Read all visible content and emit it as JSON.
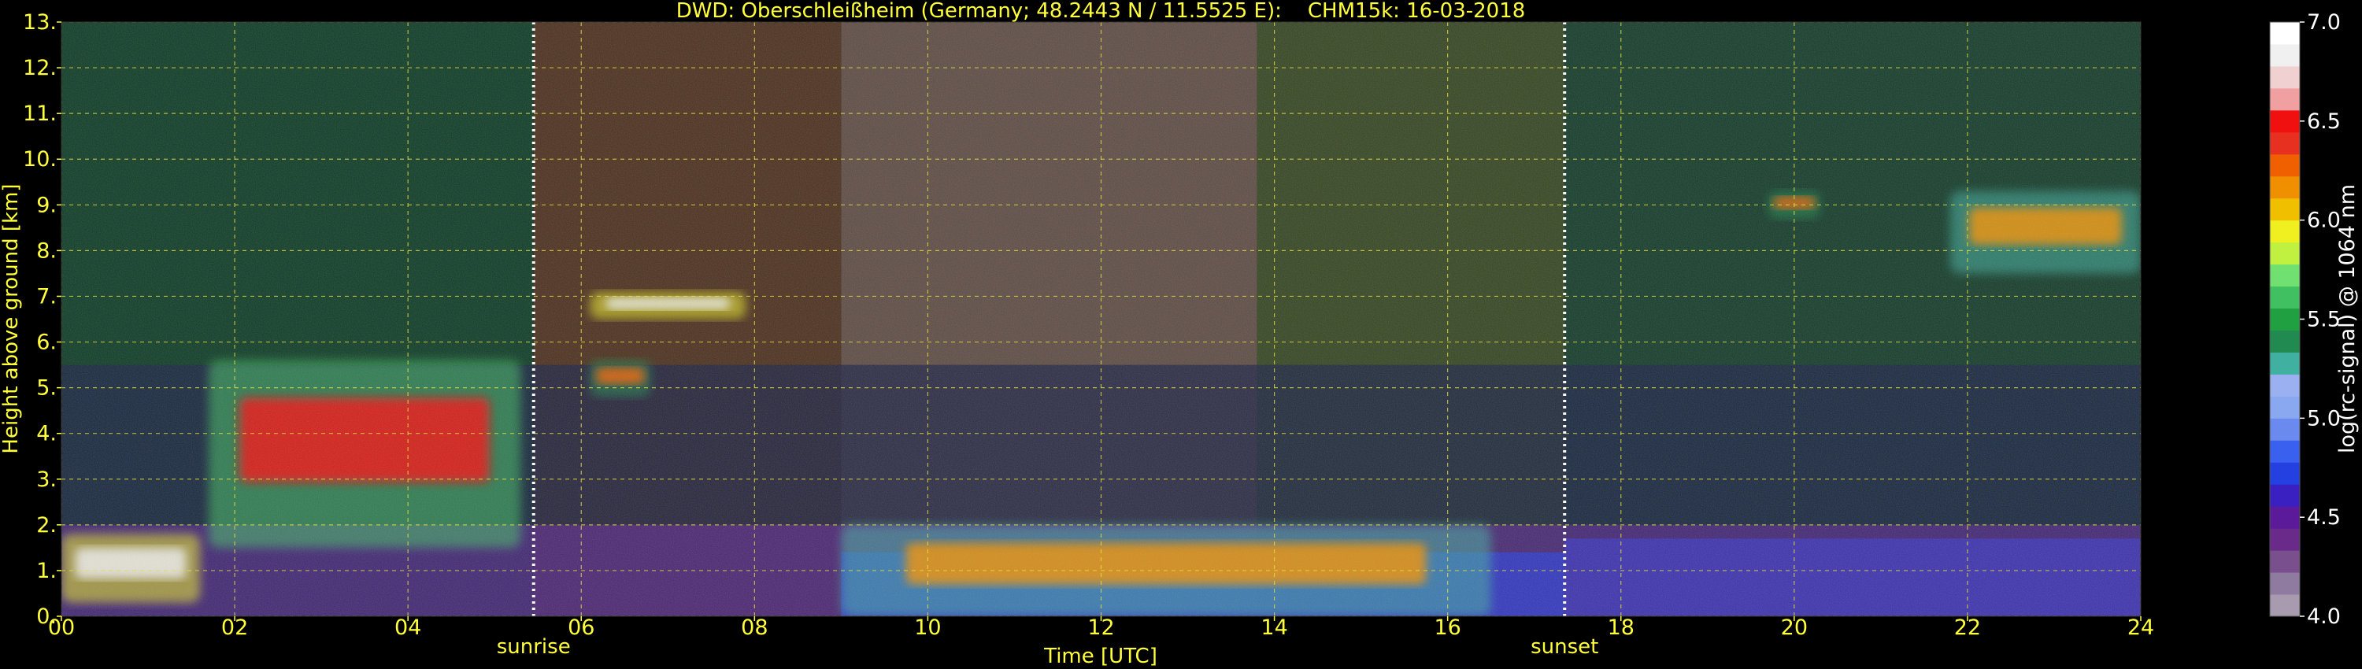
{
  "chart_data": {
    "type": "heatmap",
    "title": "DWD: Oberschleißheim (Germany; 48.2443 N / 11.5525 E):    CHM15k: 16-03-2018",
    "xlabel": "Time [UTC]",
    "ylabel": "Height above ground [km]",
    "xlim": [
      0,
      24
    ],
    "ylim": [
      0,
      13
    ],
    "grid": true,
    "x_ticks": [
      "00",
      "02",
      "04",
      "06",
      "08",
      "10",
      "12",
      "14",
      "16",
      "18",
      "20",
      "22",
      "24"
    ],
    "y_ticks": [
      "0.",
      "1.",
      "2.",
      "3.",
      "4.",
      "5.",
      "6.",
      "7.",
      "8.",
      "9.",
      "10.",
      "11.",
      "12.",
      "13."
    ],
    "annotations": [
      {
        "label": "sunrise",
        "x": 5.45
      },
      {
        "label": "sunset",
        "x": 17.35
      }
    ],
    "colorbar": {
      "label": "log(rc-signal) @ 1064 nm",
      "range": [
        4.0,
        7.0
      ],
      "ticks": [
        "4.0",
        "4.5",
        "5.0",
        "5.5",
        "6.0",
        "6.5",
        "7.0"
      ],
      "colors": [
        "#a89bb0",
        "#8f7aa0",
        "#7a4f8e",
        "#6a2a8a",
        "#5a1a9a",
        "#3a20c0",
        "#2440e0",
        "#3a60f0",
        "#6a8af0",
        "#8aa8f0",
        "#9ab0f0",
        "#40b0a0",
        "#208a50",
        "#20a040",
        "#40c060",
        "#70e070",
        "#c0f040",
        "#f0f020",
        "#f0c000",
        "#f09000",
        "#f06000",
        "#e83020",
        "#f01010",
        "#f0a0a0",
        "#f0d0d0",
        "#f0f0f0",
        "#ffffff"
      ]
    },
    "features": [
      {
        "kind": "boundary-layer",
        "x": [
          0,
          1.6
        ],
        "y": [
          0.3,
          1.8
        ],
        "level": 6.8
      },
      {
        "kind": "cloud",
        "x": [
          1.7,
          5.3
        ],
        "y": [
          1.5,
          5.6
        ],
        "level": 6.5
      },
      {
        "kind": "cloud",
        "x": [
          6.1,
          7.9
        ],
        "y": [
          6.5,
          7.1
        ],
        "level": 6.8
      },
      {
        "kind": "cloud",
        "x": [
          6.1,
          6.8
        ],
        "y": [
          4.8,
          5.6
        ],
        "level": 6.3
      },
      {
        "kind": "boundary-layer",
        "x": [
          9.0,
          16.5
        ],
        "y": [
          0.0,
          2.0
        ],
        "level": 6.2
      },
      {
        "kind": "cloud",
        "x": [
          19.7,
          20.3
        ],
        "y": [
          8.7,
          9.3
        ],
        "level": 6.3
      },
      {
        "kind": "cloud",
        "x": [
          21.8,
          24.0
        ],
        "y": [
          7.5,
          9.3
        ],
        "level": 6.2
      }
    ]
  }
}
